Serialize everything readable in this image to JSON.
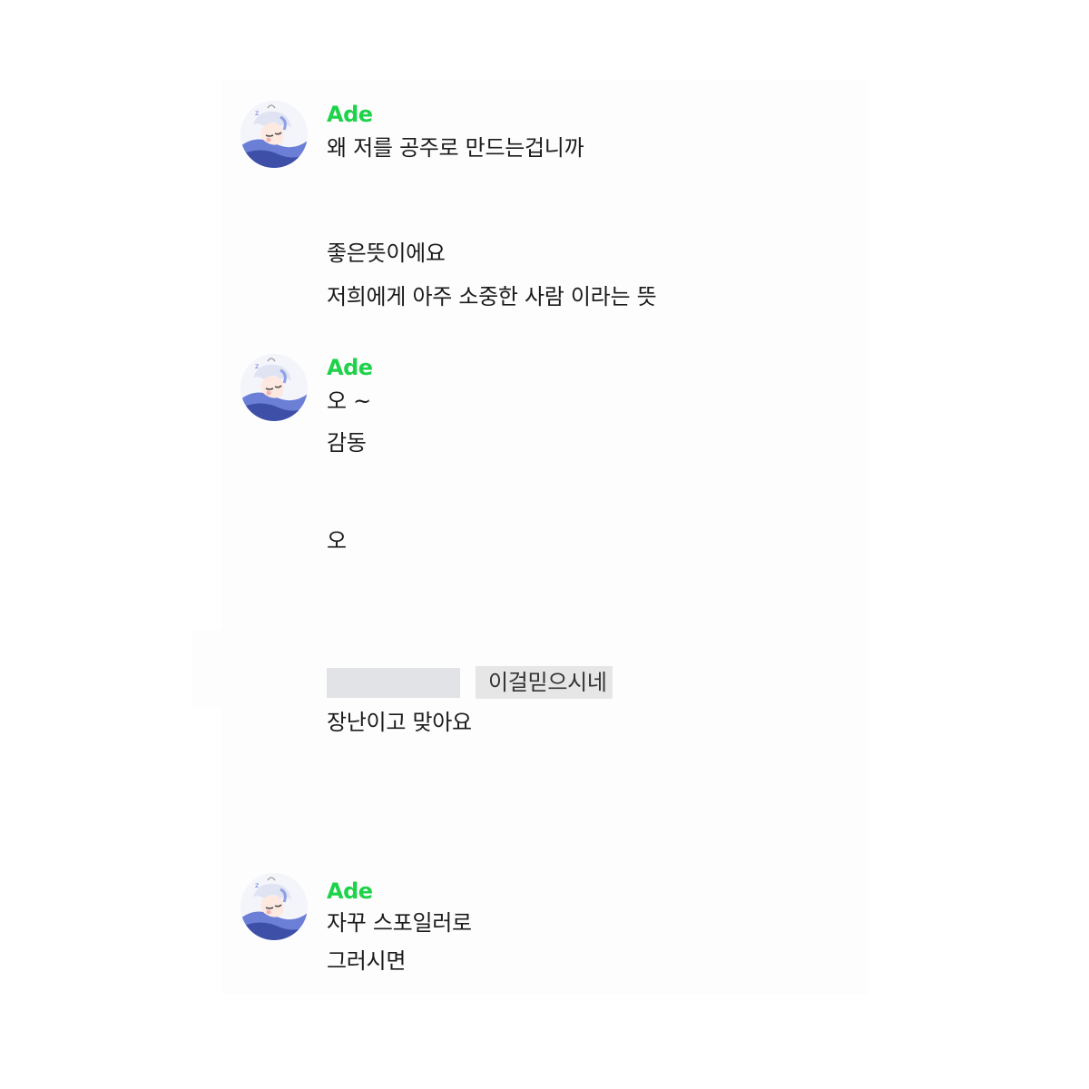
{
  "messages": [
    {
      "sender": "Ade",
      "lines": [
        "왜 저를 공주로 만드는겁니까"
      ]
    },
    {
      "sender": "",
      "lines": [
        "좋은뜻이에요",
        "저희에게 아주 소중한 사람 이라는 뜻"
      ]
    },
    {
      "sender": "Ade",
      "lines": [
        "오 ~",
        "감동"
      ]
    },
    {
      "sender": "",
      "lines": [
        "오",
        "이걸믿으시네",
        "장난이고 맞아요"
      ]
    },
    {
      "sender": "Ade",
      "lines": [
        "자꾸 스포일러로",
        "그러시면"
      ]
    }
  ],
  "icons": {
    "avatar": "anime-character-sleeping-avatar-icon"
  },
  "colors": {
    "sender_name": "#1ed24a",
    "message_text": "#1b1b1b",
    "redaction": "#e2e3e6",
    "highlight": "#e6e6e6"
  }
}
